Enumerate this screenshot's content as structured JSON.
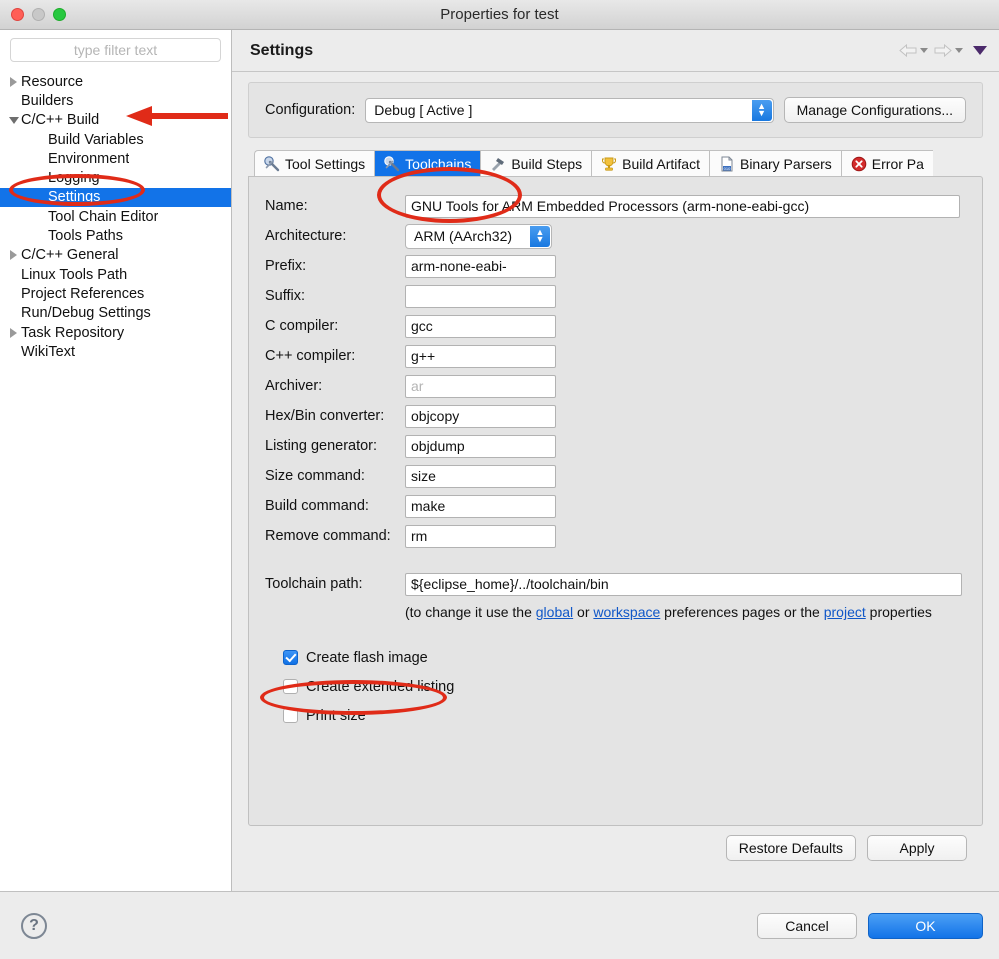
{
  "window": {
    "title": "Properties for test",
    "controls": [
      "close",
      "minimize",
      "zoom"
    ]
  },
  "sidebar": {
    "filter_placeholder": "type filter text",
    "items": [
      {
        "label": "Resource",
        "level": 0,
        "twisty": "collapsed",
        "selected": false
      },
      {
        "label": "Builders",
        "level": 0,
        "twisty": "none",
        "selected": false
      },
      {
        "label": "C/C++ Build",
        "level": 0,
        "twisty": "expanded",
        "selected": false
      },
      {
        "label": "Build Variables",
        "level": 1,
        "twisty": "none",
        "selected": false
      },
      {
        "label": "Environment",
        "level": 1,
        "twisty": "none",
        "selected": false
      },
      {
        "label": "Logging",
        "level": 1,
        "twisty": "none",
        "selected": false
      },
      {
        "label": "Settings",
        "level": 1,
        "twisty": "none",
        "selected": true
      },
      {
        "label": "Tool Chain Editor",
        "level": 1,
        "twisty": "none",
        "selected": false
      },
      {
        "label": "Tools Paths",
        "level": 1,
        "twisty": "none",
        "selected": false
      },
      {
        "label": "C/C++ General",
        "level": 0,
        "twisty": "collapsed",
        "selected": false
      },
      {
        "label": "Linux Tools Path",
        "level": 0,
        "twisty": "none",
        "selected": false
      },
      {
        "label": "Project References",
        "level": 0,
        "twisty": "none",
        "selected": false
      },
      {
        "label": "Run/Debug Settings",
        "level": 0,
        "twisty": "none",
        "selected": false
      },
      {
        "label": "Task Repository",
        "level": 0,
        "twisty": "collapsed",
        "selected": false
      },
      {
        "label": "WikiText",
        "level": 0,
        "twisty": "none",
        "selected": false
      }
    ]
  },
  "header": {
    "title": "Settings",
    "back_icon": "back-arrow-icon",
    "forward_icon": "forward-arrow-icon",
    "menu_icon": "view-menu-triangle-icon"
  },
  "configuration": {
    "label": "Configuration:",
    "value": "Debug  [ Active ]",
    "manage_button": "Manage Configurations..."
  },
  "tabs": [
    {
      "label": "Tool Settings",
      "icon": "wrench-screwdriver-icon",
      "active": false
    },
    {
      "label": "Toolchains",
      "icon": "wrench-screwdriver-icon",
      "active": true
    },
    {
      "label": "Build Steps",
      "icon": "hammer-icon",
      "active": false
    },
    {
      "label": "Build Artifact",
      "icon": "trophy-icon",
      "active": false
    },
    {
      "label": "Binary Parsers",
      "icon": "binary-document-icon",
      "active": false
    },
    {
      "label": "Error Pa",
      "icon": "error-circle-icon",
      "active": false
    }
  ],
  "form": {
    "fields": [
      {
        "label": "Name:",
        "value": "GNU Tools for ARM Embedded Processors (arm-none-eabi-gcc)",
        "type": "text",
        "width": "full",
        "ghost": false
      },
      {
        "label": "Architecture:",
        "value": "ARM (AArch32)",
        "type": "combo",
        "width": "arch",
        "ghost": false
      },
      {
        "label": "Prefix:",
        "value": "arm-none-eabi-",
        "type": "text",
        "width": "small",
        "ghost": false
      },
      {
        "label": "Suffix:",
        "value": "",
        "type": "text",
        "width": "small",
        "ghost": false
      },
      {
        "label": "C compiler:",
        "value": "gcc",
        "type": "text",
        "width": "small",
        "ghost": false
      },
      {
        "label": "C++ compiler:",
        "value": "g++",
        "type": "text",
        "width": "small",
        "ghost": false
      },
      {
        "label": "Archiver:",
        "value": "ar",
        "type": "text",
        "width": "small",
        "ghost": true
      },
      {
        "label": "Hex/Bin converter:",
        "value": "objcopy",
        "type": "text",
        "width": "small",
        "ghost": false
      },
      {
        "label": "Listing generator:",
        "value": "objdump",
        "type": "text",
        "width": "small",
        "ghost": false
      },
      {
        "label": "Size command:",
        "value": "size",
        "type": "text",
        "width": "small",
        "ghost": false
      },
      {
        "label": "Build command:",
        "value": "make",
        "type": "text",
        "width": "small",
        "ghost": false
      },
      {
        "label": "Remove command:",
        "value": "rm",
        "type": "text",
        "width": "small",
        "ghost": false
      }
    ],
    "toolchain_path": {
      "label": "Toolchain path:",
      "value": "${eclipse_home}/../toolchain/bin"
    },
    "hint": {
      "prefix": "(to change it use the ",
      "link_global": "global",
      "mid1": " or ",
      "link_workspace": "workspace",
      "mid2": " preferences pages or the ",
      "link_project": "project",
      "suffix": " properties"
    },
    "checkboxes": [
      {
        "label": "Create flash image",
        "checked": true
      },
      {
        "label": "Create extended listing",
        "checked": false
      },
      {
        "label": "Print size",
        "checked": false
      }
    ]
  },
  "panel_buttons": {
    "restore_defaults": "Restore Defaults",
    "apply": "Apply"
  },
  "dialog_buttons": {
    "help_icon": "help-question-icon",
    "cancel": "Cancel",
    "ok": "OK"
  },
  "annotations": {
    "color": "#e02b18",
    "marks": [
      {
        "kind": "ellipse",
        "target": "sidebar-settings"
      },
      {
        "kind": "arrow",
        "target": "sidebar-cpp-build"
      },
      {
        "kind": "ellipse",
        "target": "tab-toolchains"
      },
      {
        "kind": "ellipse",
        "target": "create-flash-image-checkbox"
      }
    ]
  },
  "colors": {
    "selection_blue": "#1273e8",
    "annotation_red": "#e02b18",
    "link_blue": "#1057c8",
    "window_chrome": "#ececec"
  }
}
